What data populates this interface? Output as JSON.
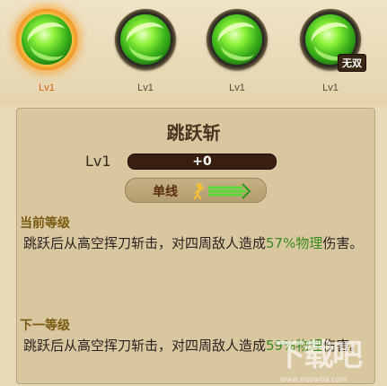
{
  "skills": [
    {
      "level": "Lv1",
      "selected": true,
      "badge": ""
    },
    {
      "level": "Lv1",
      "selected": false,
      "badge": ""
    },
    {
      "level": "Lv1",
      "selected": false,
      "badge": ""
    },
    {
      "level": "Lv1",
      "selected": false,
      "badge": "无双"
    }
  ],
  "detail": {
    "title": "跳跃斩",
    "level_label": "Lv1",
    "exp_text": "+0",
    "exp_fraction": 0.0,
    "tag_label": "单线",
    "current_header": "当前等级",
    "current_desc_pre": "跳跃后从高空挥刀斩击，对四周敌人造成",
    "current_desc_hl": "57%物理",
    "current_desc_post": "伤害。",
    "next_header": "下一等级",
    "next_desc_pre": "跳跃后从高空挥刀斩击，对四周敌人造成",
    "next_desc_hl": "59%物理",
    "next_desc_post": "伤害。"
  },
  "watermark": {
    "text": "下载吧",
    "url": "www.xiazaiba.com"
  }
}
